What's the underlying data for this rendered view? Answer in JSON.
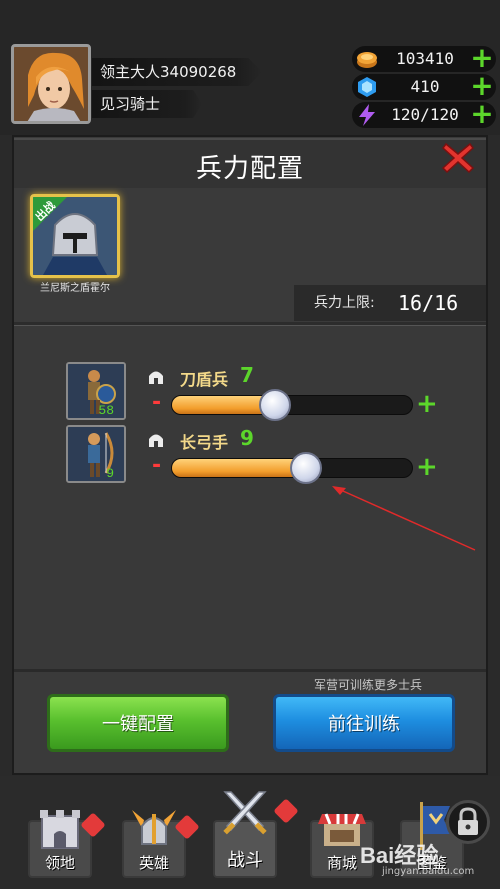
{
  "player": {
    "name": "领主大人34090268",
    "rank": "见习骑士",
    "avatar_icon": "female-knight-portrait-icon"
  },
  "resources": [
    {
      "icon": "gold-coin-icon",
      "value": "103410",
      "plus": "+"
    },
    {
      "icon": "blue-gem-icon",
      "value": "410",
      "plus": "+"
    },
    {
      "icon": "lightning-energy-icon",
      "value": "120/120",
      "plus": "+"
    }
  ],
  "panel": {
    "title": "兵力配置",
    "close_icon": "red-x-close-icon",
    "hero": {
      "badge": "出战",
      "name": "兰尼斯之盾霍尔"
    },
    "capacity": {
      "label": "兵力上限:",
      "value": "16/16"
    }
  },
  "units": [
    {
      "name": "刀盾兵",
      "count": "7",
      "available": "58",
      "slider_fraction": 0.43,
      "icon": "sword-shield-soldier-icon"
    },
    {
      "name": "长弓手",
      "count": "9",
      "available": "9",
      "slider_fraction": 0.56,
      "icon": "longbow-archer-icon"
    }
  ],
  "controls": {
    "minus": "-",
    "plus": "+"
  },
  "footer": {
    "note": "军营可训练更多士兵",
    "auto_button": "一键配置",
    "train_button": "前往训练"
  },
  "nav": [
    {
      "label": "领地",
      "icon": "castle-icon"
    },
    {
      "label": "英雄",
      "icon": "winged-helmet-icon"
    },
    {
      "label": "战斗",
      "icon": "crossed-swords-icon"
    },
    {
      "label": "商城",
      "icon": "shop-stall-icon"
    },
    {
      "label": "图鉴",
      "icon": "banner-flag-icon"
    }
  ],
  "watermark": {
    "main": "Bai经验",
    "sub": "jingyan.baidu.com"
  },
  "colors": {
    "accent_green": "#5cd62b",
    "accent_red": "#ff3b3b",
    "slider_orange": "#f29d2b",
    "button_green": "#59c02e",
    "button_blue": "#1e8ee0"
  }
}
